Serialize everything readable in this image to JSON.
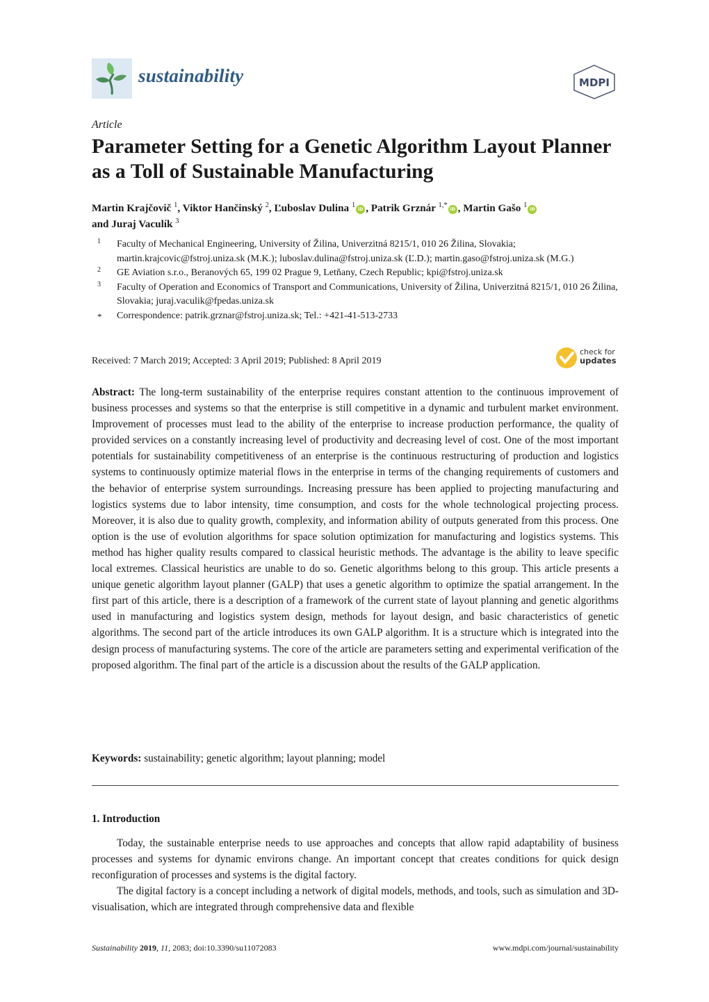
{
  "header": {
    "journal_name": "sustainability",
    "publisher_logo": "MDPI",
    "logo_icon": "sprout-leaf-icon"
  },
  "article_type": "Article",
  "title": "Parameter Setting for a Genetic Algorithm Layout Planner as a Toll of Sustainable Manufacturing",
  "authors": [
    {
      "name": "Martin Krajčovič",
      "sup": "1",
      "orcid": false,
      "sep": ", "
    },
    {
      "name": "Viktor Hančinský",
      "sup": "2",
      "orcid": false,
      "sep": ", "
    },
    {
      "name": "Ľuboslav Dulina",
      "sup": "1",
      "orcid": true,
      "sep": ", "
    },
    {
      "name": "Patrik Grznár",
      "sup": "1,*",
      "orcid": true,
      "sep": ", "
    },
    {
      "name": "Martin Gašo",
      "sup": "1",
      "orcid": true,
      "sep": " "
    },
    {
      "name": "and Juraj Vaculík",
      "sup": "3",
      "orcid": false,
      "sep": ""
    }
  ],
  "orcid_label": "iD",
  "affiliations": [
    {
      "mark": "1",
      "text": "Faculty of Mechanical Engineering, University of Žilina, Univerzitná 8215/1, 010 26 Žilina, Slovakia; martin.krajcovic@fstroj.uniza.sk (M.K.); luboslav.dulina@fstroj.uniza.sk (Ľ.D.); martin.gaso@fstroj.uniza.sk (M.G.)"
    },
    {
      "mark": "2",
      "text": "GE Aviation s.r.o., Beranových 65, 199 02 Prague 9, Letňany, Czech Republic; kpi@fstroj.uniza.sk"
    },
    {
      "mark": "3",
      "text": "Faculty of Operation and Economics of Transport and Communications, University of Žilina, Univerzitná 8215/1, 010 26 Žilina, Slovakia; juraj.vaculik@fpedas.uniza.sk"
    },
    {
      "mark": "*",
      "text": "Correspondence: patrik.grznar@fstroj.uniza.sk; Tel.: +421-41-513-2733"
    }
  ],
  "dates": "Received: 7 March 2019; Accepted: 3 April 2019; Published: 8 April 2019",
  "check_updates": {
    "line1": "check for",
    "line2": "updates"
  },
  "abstract": {
    "label": "Abstract:",
    "text": "The long-term sustainability of the enterprise requires constant attention to the continuous improvement of business processes and systems so that the enterprise is still competitive in a dynamic and turbulent market environment. Improvement of processes must lead to the ability of the enterprise to increase production performance, the quality of provided services on a constantly increasing level of productivity and decreasing level of cost. One of the most important potentials for sustainability competitiveness of an enterprise is the continuous restructuring of production and logistics systems to continuously optimize material flows in the enterprise in terms of the changing requirements of customers and the behavior of enterprise system surroundings. Increasing pressure has been applied to projecting manufacturing and logistics systems due to labor intensity, time consumption, and costs for the whole technological projecting process.  Moreover, it is also due to quality growth, complexity, and information ability of outputs generated from this process. One option is the use of evolution algorithms for space solution optimization for manufacturing and logistics systems. This method has higher quality results compared to classical heuristic methods. The advantage is the ability to leave specific local extremes.  Classical heuristics are unable to do so. Genetic algorithms belong to this group. This article presents a unique genetic algorithm layout planner (GALP) that uses a genetic algorithm to optimize the spatial arrangement. In the first part of this article, there is a description of a framework of the current state of layout planning and genetic algorithms used in manufacturing and logistics system design, methods for layout design, and basic characteristics of genetic algorithms. The second part of the article introduces its own GALP algorithm.  It is a structure which is integrated into the design process of manufacturing systems. The core of the article are parameters setting and experimental verification of the proposed algorithm. The final part of the article is a discussion about the results of the GALP application."
  },
  "keywords": {
    "label": "Keywords:",
    "text": "sustainability; genetic algorithm; layout planning; model"
  },
  "section": {
    "heading": "1. Introduction",
    "paragraphs": [
      "Today, the sustainable enterprise needs to use approaches and concepts that allow rapid adaptability of business processes and systems for dynamic environs change. An important concept that creates conditions for quick design reconfiguration of processes and systems is the digital factory.",
      "The digital factory is a concept including a network of digital models, methods, and tools, such as simulation and 3D-visualisation, which are integrated through comprehensive data and flexible"
    ]
  },
  "footer": {
    "journal": "Sustainability",
    "year": "2019",
    "volume": "11",
    "rest": ", 2083; doi:10.3390/su11072083",
    "url": "www.mdpi.com/journal/sustainability"
  }
}
